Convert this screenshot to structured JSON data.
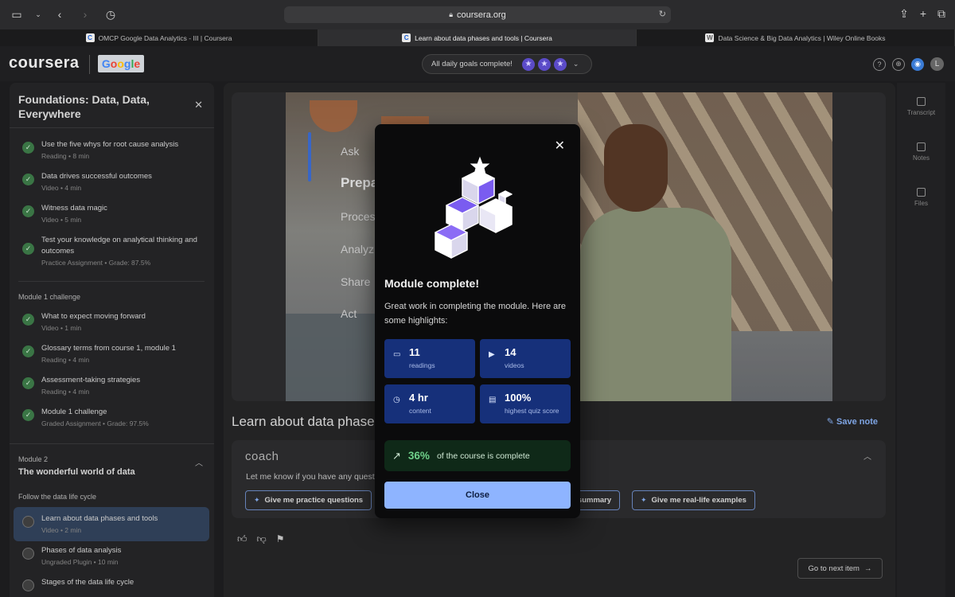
{
  "browser": {
    "url": "coursera.org",
    "tabs": [
      {
        "label": "OMCP Google Data Analytics - III | Coursera",
        "favicon": "C"
      },
      {
        "label": "Learn about data phases and tools | Coursera",
        "favicon": "C"
      },
      {
        "label": "Data Science & Big Data Analytics | Wiley Online Books",
        "favicon": "W"
      }
    ]
  },
  "header": {
    "logo": "coursera",
    "partner": "Google",
    "goals_text": "All daily goals complete!",
    "avatar_initial": "L"
  },
  "sidebar": {
    "title": "Foundations: Data, Data, Everywhere",
    "items_top": [
      {
        "title": "Use the five whys for root cause analysis",
        "sub": "Reading • 8 min"
      },
      {
        "title": "Data drives successful outcomes",
        "sub": "Video • 4 min"
      },
      {
        "title": "Witness data magic",
        "sub": "Video • 5 min"
      },
      {
        "title": "Test your knowledge on analytical thinking and outcomes",
        "sub": "Practice Assignment • Grade: 87.5%"
      }
    ],
    "challenge_label": "Module 1 challenge",
    "items_challenge": [
      {
        "title": "What to expect moving forward",
        "sub": "Video • 1 min"
      },
      {
        "title": "Glossary terms from course 1, module 1",
        "sub": "Reading • 4 min"
      },
      {
        "title": "Assessment-taking strategies",
        "sub": "Reading • 4 min"
      },
      {
        "title": "Module 1 challenge",
        "sub": "Graded Assignment • Grade: 97.5%"
      }
    ],
    "module2_label": "Module 2",
    "module2_title": "The wonderful world of data",
    "lifecycle_label": "Follow the data life cycle",
    "items_module2": [
      {
        "title": "Learn about data phases and tools",
        "sub": "Video • 2 min"
      },
      {
        "title": "Phases of data analysis",
        "sub": "Ungraded Plugin • 10 min"
      },
      {
        "title": "Stages of the data life cycle",
        "sub": ""
      }
    ]
  },
  "video": {
    "phases": [
      "Ask",
      "Prepa",
      "Proces",
      "Analyz",
      "Share",
      "Act"
    ]
  },
  "main": {
    "lesson_title": "Learn about data phases",
    "save_note": "Save note",
    "coach_logo": "coach",
    "coach_question": "Let me know if you have any quest",
    "chips": [
      "Give me practice questions",
      "a summary",
      "Give me real-life examples"
    ],
    "next_button": "Go to next item"
  },
  "rail": [
    "Transcript",
    "Notes",
    "Files"
  ],
  "modal": {
    "title": "Module complete!",
    "description": "Great work in completing the module. Here are some highlights:",
    "stats": [
      {
        "value": "11",
        "label": "readings",
        "icon": "book-icon"
      },
      {
        "value": "14",
        "label": "videos",
        "icon": "video-icon"
      },
      {
        "value": "4 hr",
        "label": "content",
        "icon": "clock-icon"
      },
      {
        "value": "100%",
        "label": "highest quiz score",
        "icon": "quiz-icon"
      }
    ],
    "progress_pct": "36%",
    "progress_text": "of the course is complete",
    "close_label": "Close"
  }
}
